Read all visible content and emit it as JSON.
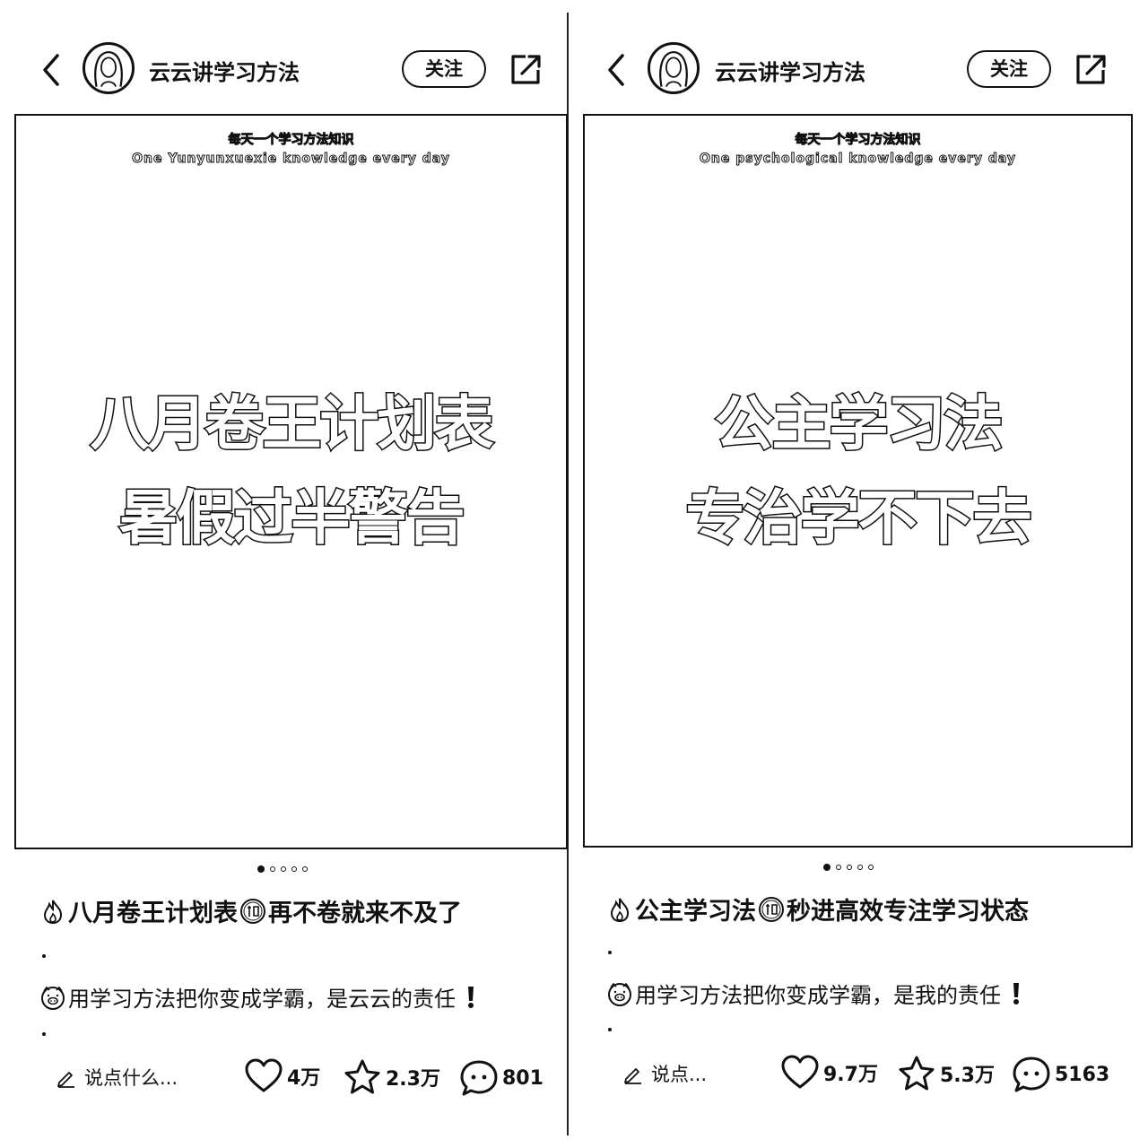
{
  "posts": [
    {
      "author": "云云讲学习方法",
      "follow_label": "关注",
      "card_header_zh": "每天一个学习方法知识",
      "card_header_en": "One Yunyunxuexie knowledge every day",
      "card_line1": "八月卷王计划表",
      "card_line2": "暑假过半警告",
      "carousel_total": 5,
      "carousel_active": 1,
      "title_prefix": "八月卷王计划表",
      "title_suffix": "再不卷就来不及了",
      "body": "用学习方法把你变成学霸，是云云的责任",
      "comment_placeholder": "说点什么...",
      "likes": "4万",
      "favorites": "2.3万",
      "comments": "801"
    },
    {
      "author": "云云讲学习方法",
      "follow_label": "关注",
      "card_header_zh": "每天一个学习方法知识",
      "card_header_en": "One psychological knowledge every day",
      "card_line1": "公主学习法",
      "card_line2": "专治学不下去",
      "carousel_total": 5,
      "carousel_active": 1,
      "title_prefix": "公主学习法",
      "title_suffix": "秒进高效专注学习状态",
      "body": "用学习方法把你变成学霸，是我的责任",
      "comment_placeholder": "说点...",
      "likes": "9.7万",
      "favorites": "5.3万",
      "comments": "5163"
    }
  ],
  "icons": [
    "back-chevron-icon",
    "avatar",
    "share-icon",
    "fire-icon",
    "secret-badge-icon",
    "pig-face-icon",
    "exclamation-icon",
    "pencil-icon",
    "heart-icon",
    "star-icon",
    "comment-bubble-icon"
  ]
}
